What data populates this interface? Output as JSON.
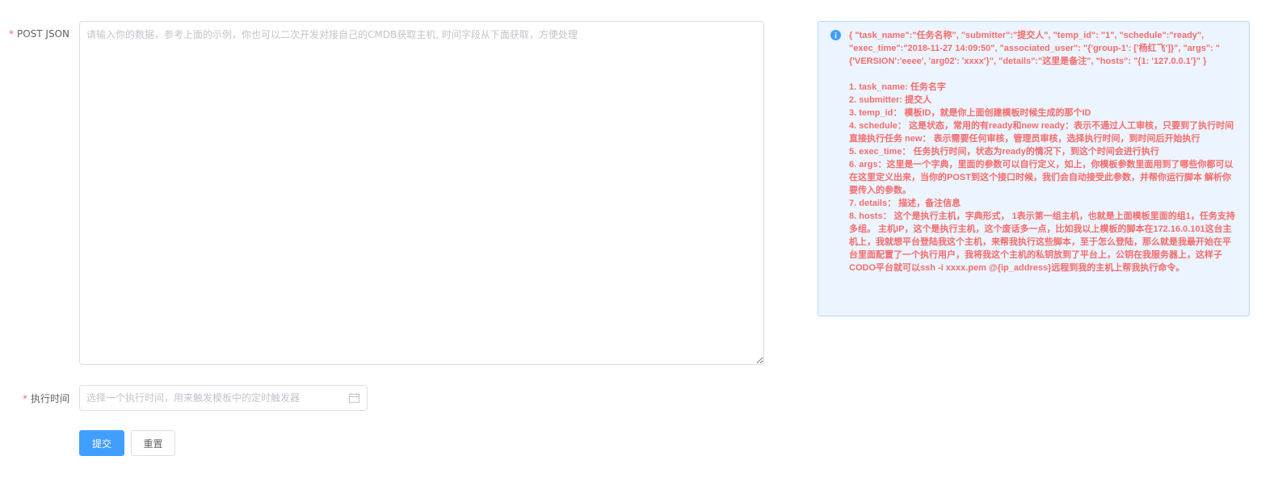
{
  "form": {
    "json_field": {
      "required_mark": "*",
      "label": "POST JSON",
      "placeholder": "请输入你的数据，参考上面的示例，你也可以二次开发对接自己的CMDB获取主机, 时间字段从下面获取，方便处理",
      "value": ""
    },
    "time_field": {
      "required_mark": "*",
      "label": "执行时间",
      "placeholder": "选择一个执行时间，用来触发模板中的定时触发器",
      "value": ""
    },
    "buttons": {
      "submit_label": "提交",
      "reset_label": "重置"
    }
  },
  "help": {
    "icon": "info-icon",
    "example_json": "{ \"task_name\":\"任务名称\", \"submitter\":\"提交人\", \"temp_id\": \"1\", \"schedule\":\"ready\", \"exec_time\":\"2018-11-27 14:09:50\", \"associated_user\": \"{'group-1': ['杨红飞']}\", \"args\": \"{'VERSION':'eeee', 'arg02': 'xxxx'}\", \"details\":\"这里是备注\", \"hosts\": \"{1: '127.0.0.1'}\" }",
    "items": [
      "1. task_name: 任务名字",
      "2. submitter: 提交人",
      "3. temp_id： 模板ID，就是你上面创建模板时候生成的那个ID",
      "4. schedule： 这是状态，常用的有ready和new ready：表示不通过人工审核，只要到了执行时间直接执行任务 new： 表示需要任何审核，管理员审核，选择执行时间，到时间后开始执行",
      "5. exec_time： 任务执行时间，状态为ready的情况下，到这个时间会进行执行",
      "6. args：这里是一个字典，里面的参数可以自行定义，如上，你模板参数里面用到了哪些你都可以在这里定义出来，当你的POST到这个接口时候，我们会自动接受此参数，并帮你运行脚本 解析你要传入的参数。",
      "7. details： 描述，备注信息",
      "8. hosts： 这个是执行主机，字典形式， 1表示第一组主机，也就是上面模板里面的组1，任务支持多组。 主机IP，这个是执行主机，这个废话多一点，比如我以上模板的脚本在172.16.0.101这台主机上，我就想平台登陆我这个主机，来帮我执行这些脚本，至于怎么登陆，那么就是我最开始在平台里面配置了一个执行用户，我将我这个主机的私钥放到了平台上，公钥在我服务器上，这样子CODO平台就可以ssh -i xxxx.pem @{ip_address}远程到我的主机上帮我执行命令。"
    ]
  },
  "colors": {
    "primary": "#409eff",
    "danger": "#f56c6c",
    "alert_bg": "#ecf5ff",
    "alert_border": "#b3d8ff"
  }
}
